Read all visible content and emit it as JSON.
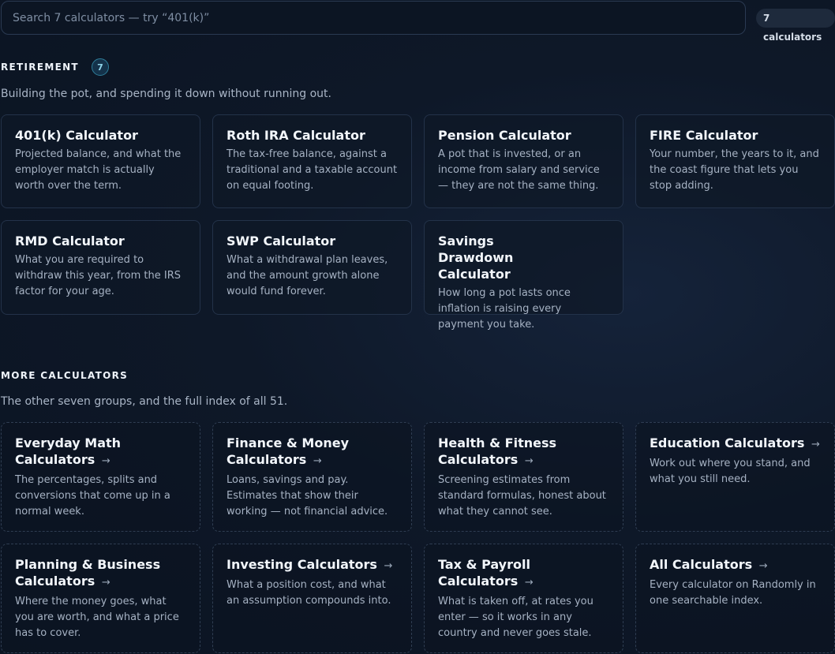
{
  "search": {
    "placeholder": "Search 7 calculators — try “401(k)”",
    "count_label": "7 calculators"
  },
  "retirement": {
    "heading": "RETIREMENT",
    "count": "7",
    "description": "Building the pot, and spending it down without running out.",
    "cards": [
      {
        "title": "401(k) Calculator",
        "desc": "Projected balance, and what the employer match is actually worth over the term."
      },
      {
        "title": "Roth IRA Calculator",
        "desc": "The tax-free balance, against a traditional and a taxable account on equal footing."
      },
      {
        "title": "Pension Calculator",
        "desc": "A pot that is invested, or an income from salary and service — they are not the same thing."
      },
      {
        "title": "FIRE Calculator",
        "desc": "Your number, the years to it, and the coast figure that lets you stop adding."
      },
      {
        "title": "RMD Calculator",
        "desc": "What you are required to withdraw this year, from the IRS factor for your age."
      },
      {
        "title": "SWP Calculator",
        "desc": "What a withdrawal plan leaves, and the amount growth alone would fund forever."
      },
      {
        "title": "Savings Drawdown Calculator",
        "desc": "How long a pot lasts once inflation is raising every payment you take."
      }
    ]
  },
  "more": {
    "heading": "MORE CALCULATORS",
    "description": "The other seven groups, and the full index of all 51.",
    "arrow": "→",
    "cards": [
      {
        "title": "Everyday Math Calculators",
        "desc": "The percentages, splits and conversions that come up in a normal week."
      },
      {
        "title": "Finance & Money Calculators",
        "desc": "Loans, savings and pay. Estimates that show their working — not financial advice."
      },
      {
        "title": "Health & Fitness Calculators",
        "desc": "Screening estimates from standard formulas, honest about what they cannot see."
      },
      {
        "title": "Education Calculators",
        "desc": "Work out where you stand, and what you still need."
      },
      {
        "title": "Planning & Business Calculators",
        "desc": "Where the money goes, what you are worth, and what a price has to cover."
      },
      {
        "title": "Investing Calculators",
        "desc": "What a position cost, and what an assumption compounds into."
      },
      {
        "title": "Tax & Payroll Calculators",
        "desc": "What is taken off, at rates you enter — so it works in any country and never goes stale."
      },
      {
        "title": "All Calculators",
        "desc": "Every calculator on Randomly in one searchable index."
      }
    ]
  }
}
